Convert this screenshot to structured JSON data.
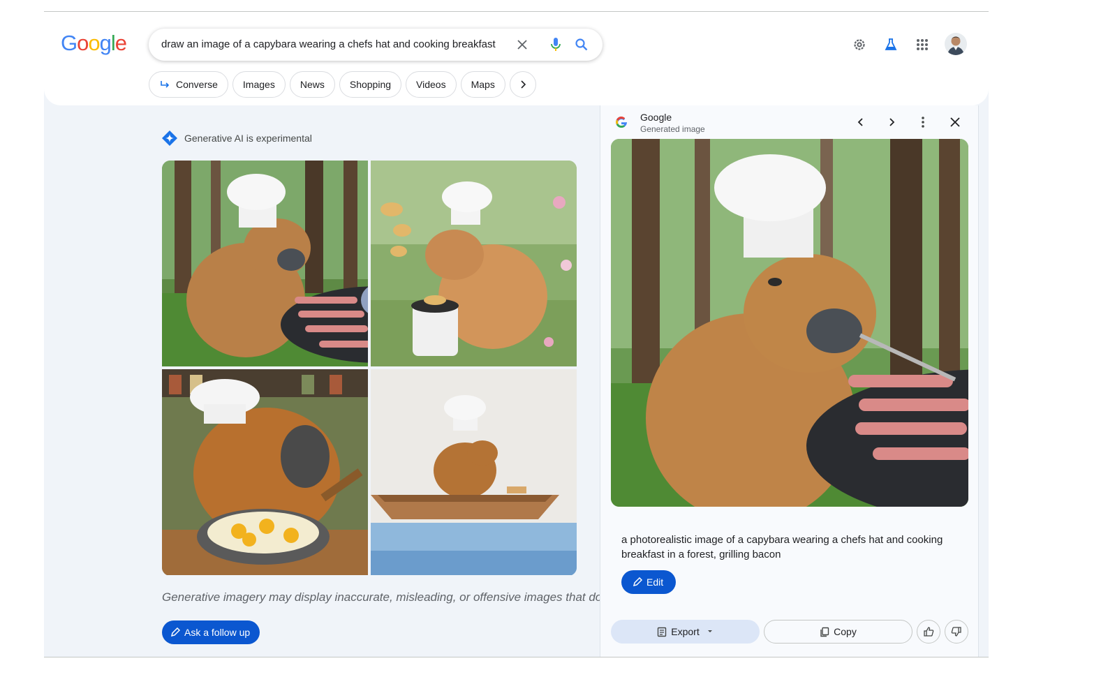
{
  "logo": {
    "letters": [
      "G",
      "o",
      "o",
      "g",
      "l",
      "e"
    ],
    "colors": [
      "#4285f4",
      "#ea4335",
      "#fbbc05",
      "#4285f4",
      "#34a853",
      "#ea4335"
    ]
  },
  "search": {
    "query": "draw an image of a capybara wearing a chefs hat and cooking breakfast"
  },
  "header_icons": [
    "settings-icon",
    "labs-flask-icon",
    "apps-grid-icon",
    "account-avatar"
  ],
  "chips": [
    "Converse",
    "Images",
    "News",
    "Shopping",
    "Videos",
    "Maps"
  ],
  "genai": {
    "label": "Generative AI is experimental"
  },
  "disclaimer": "Generative imagery may display inaccurate, misleading, or offensive images that do",
  "followup": {
    "label": "Ask a follow up"
  },
  "panel": {
    "title": "Google",
    "subtitle": "Generated image",
    "caption": "a photorealistic image of a capybara wearing a chefs hat and cooking breakfast in a forest, grilling bacon",
    "edit_label": "Edit",
    "export_label": "Export",
    "copy_label": "Copy"
  },
  "colors": {
    "accent": "#0b57d0",
    "background": "#f0f4f9"
  }
}
